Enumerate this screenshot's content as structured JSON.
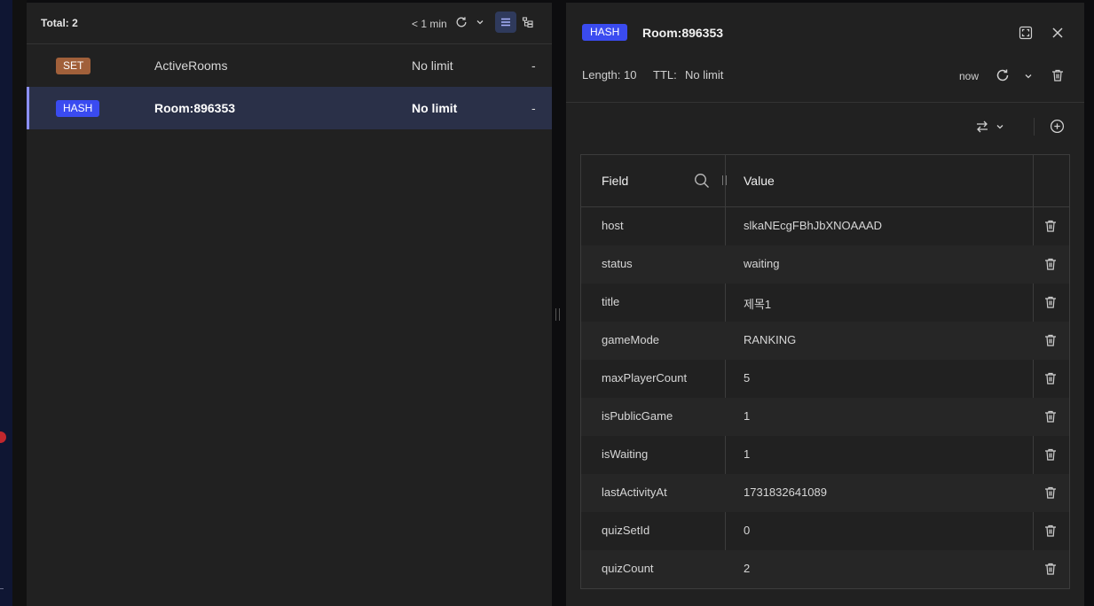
{
  "list": {
    "total_label": "Total: 2",
    "refresh_label": "< 1 min",
    "keys": [
      {
        "type": "SET",
        "name": "ActiveRooms",
        "ttl": "No limit",
        "size": "-"
      },
      {
        "type": "HASH",
        "name": "Room:896353",
        "ttl": "No limit",
        "size": "-"
      }
    ]
  },
  "details": {
    "type": "HASH",
    "key": "Room:896353",
    "length_label": "Length: 10",
    "ttl_label": "TTL:",
    "ttl_value": "No limit",
    "refresh_label": "now",
    "columns": {
      "field": "Field",
      "value": "Value"
    },
    "rows": [
      {
        "field": "host",
        "value": "slkaNEcgFBhJbXNOAAAD"
      },
      {
        "field": "status",
        "value": "waiting"
      },
      {
        "field": "title",
        "value": "제목1"
      },
      {
        "field": "gameMode",
        "value": "RANKING"
      },
      {
        "field": "maxPlayerCount",
        "value": "5"
      },
      {
        "field": "isPublicGame",
        "value": "1"
      },
      {
        "field": "isWaiting",
        "value": "1"
      },
      {
        "field": "lastActivityAt",
        "value": "1731832641089"
      },
      {
        "field": "quizSetId",
        "value": "0"
      },
      {
        "field": "quizCount",
        "value": "2"
      }
    ]
  },
  "icons": [
    "refresh-icon",
    "chevron-down-icon",
    "list-view-icon",
    "tree-view-icon",
    "expand-icon",
    "close-icon",
    "trash-icon",
    "swap-icon",
    "plus-circle-icon",
    "search-icon"
  ],
  "colors": {
    "set_badge": "#a1603a",
    "hash_badge": "#3a4bf0",
    "selected_row": "#2a3048",
    "accent": "#8b8fff"
  }
}
